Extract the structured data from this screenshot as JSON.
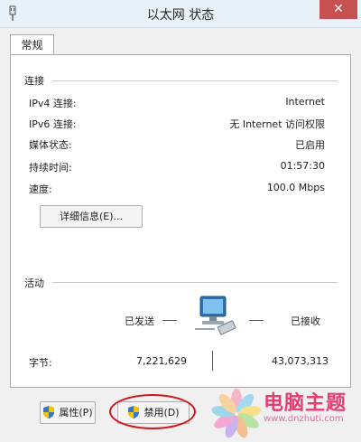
{
  "window": {
    "title": "以太网 状态",
    "close_glyph": "✕"
  },
  "tabs": [
    {
      "label": "常规"
    }
  ],
  "connection": {
    "group_label": "连接",
    "rows": [
      {
        "label": "IPv4 连接:",
        "value": "Internet"
      },
      {
        "label": "IPv6 连接:",
        "value": "无 Internet 访问权限"
      },
      {
        "label": "媒体状态:",
        "value": "已启用"
      },
      {
        "label": "持续时间:",
        "value": "01:57:30"
      },
      {
        "label": "速度:",
        "value": "100.0 Mbps"
      }
    ],
    "details_button": "详细信息(E)..."
  },
  "activity": {
    "group_label": "活动",
    "sent_label": "已发送",
    "received_label": "已接收",
    "bytes_label": "字节:",
    "bytes_sent": "7,221,629",
    "bytes_received": "43,073,313"
  },
  "buttons": {
    "properties": "属性(P)",
    "disable": "禁用(D)"
  },
  "watermark": {
    "title": "电脑主题",
    "url": "www.dnzhuti.com"
  },
  "colors": {
    "highlight_circle": "#d2141a",
    "watermark": "#e83c70"
  },
  "icons": {
    "network": "network-computer-icon",
    "shield": "uac-shield-icon"
  }
}
